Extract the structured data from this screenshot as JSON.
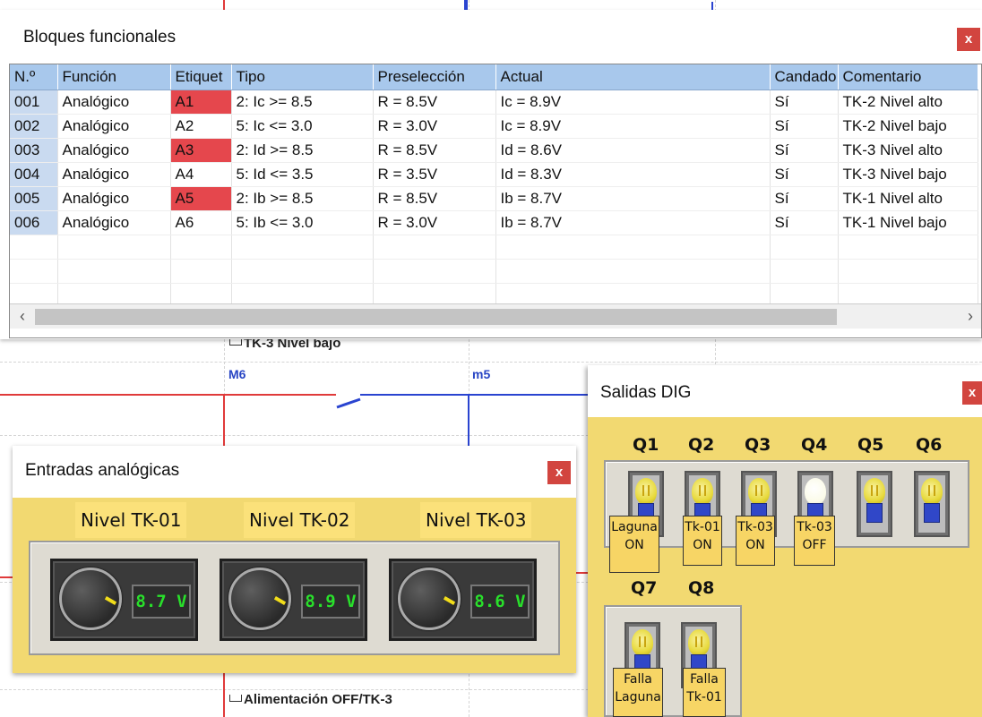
{
  "ladder": {
    "note_top": "TK-3 Nivel bajo",
    "marker_m6": "M6",
    "marker_m5": "m5",
    "note_bottom": "Alimentación OFF/TK-3"
  },
  "bloques": {
    "title": "Bloques funcionales",
    "close_label": "x",
    "columns": [
      "N.º",
      "Función",
      "Etiquet",
      "Tipo",
      "Preselección",
      "Actual",
      "Candado",
      "Comentario"
    ],
    "rows": [
      {
        "num": "001",
        "funcion": "Analógico",
        "etiqueta": "A1",
        "tipo": "2: Ic >= 8.5",
        "preseleccion": "R = 8.5V",
        "actual": "Ic = 8.9V",
        "candado": "Sí",
        "comentario": "TK-2 Nivel alto"
      },
      {
        "num": "002",
        "funcion": "Analógico",
        "etiqueta": "A2",
        "tipo": "5: Ic <= 3.0",
        "preseleccion": "R = 3.0V",
        "actual": "Ic = 8.9V",
        "candado": "Sí",
        "comentario": "TK-2 Nivel bajo"
      },
      {
        "num": "003",
        "funcion": "Analógico",
        "etiqueta": "A3",
        "tipo": "2: Id >= 8.5",
        "preseleccion": "R = 8.5V",
        "actual": "Id = 8.6V",
        "candado": "Sí",
        "comentario": "TK-3 Nivel alto"
      },
      {
        "num": "004",
        "funcion": "Analógico",
        "etiqueta": "A4",
        "tipo": "5: Id <= 3.5",
        "preseleccion": "R = 3.5V",
        "actual": "Id = 8.3V",
        "candado": "Sí",
        "comentario": "TK-3 Nivel bajo"
      },
      {
        "num": "005",
        "funcion": "Analógico",
        "etiqueta": "A5",
        "tipo": "2: Ib >= 8.5",
        "preseleccion": "R = 8.5V",
        "actual": "Ib = 8.7V",
        "candado": "Sí",
        "comentario": "TK-1 Nivel alto"
      },
      {
        "num": "006",
        "funcion": "Analógico",
        "etiqueta": "A6",
        "tipo": "5: Ib <= 3.0",
        "preseleccion": "R = 3.0V",
        "actual": "Ib = 8.7V",
        "candado": "Sí",
        "comentario": "TK-1 Nivel bajo"
      }
    ],
    "highlighted_labels": [
      "A1",
      "A3",
      "A5"
    ],
    "highlight_color": "#e5474d",
    "scroll_left_icon": "chevron-left-icon",
    "scroll_right_icon": "chevron-right-icon"
  },
  "entradas": {
    "title": "Entradas analógicas",
    "close_label": "x",
    "inputs": [
      {
        "label": "Nivel TK-01",
        "value": "8.7 V"
      },
      {
        "label": "Nivel TK-02",
        "value": "8.9 V"
      },
      {
        "label": "Nivel TK-03",
        "value": "8.6 V"
      }
    ],
    "lcd_color": "#29e02b"
  },
  "salidas": {
    "title": "Salidas DIG",
    "close_label": "x",
    "outputs": [
      {
        "q": "Q1",
        "tag": [
          "Laguna",
          "ON"
        ],
        "lit": false
      },
      {
        "q": "Q2",
        "tag": [
          "Tk-01",
          "ON"
        ],
        "lit": false
      },
      {
        "q": "Q3",
        "tag": [
          "Tk-03",
          "ON"
        ],
        "lit": false
      },
      {
        "q": "Q4",
        "tag": [
          "Tk-03",
          "OFF"
        ],
        "lit": true
      },
      {
        "q": "Q5",
        "tag": [],
        "lit": false
      },
      {
        "q": "Q6",
        "tag": [],
        "lit": false
      },
      {
        "q": "Q7",
        "tag": [
          "Falla",
          "Laguna"
        ],
        "lit": false
      },
      {
        "q": "Q8",
        "tag": [
          "Falla",
          "Tk-01"
        ],
        "lit": false
      }
    ],
    "panel_color": "#f2d971"
  }
}
